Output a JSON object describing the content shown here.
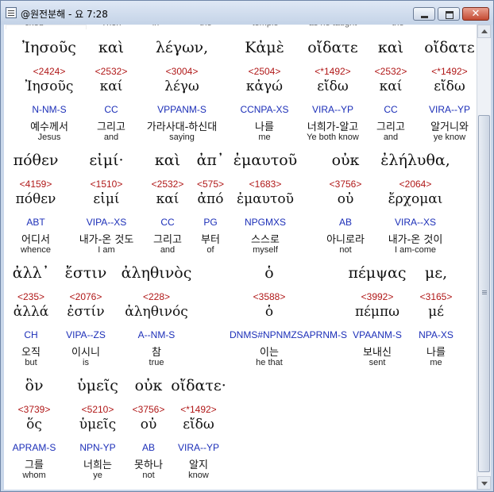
{
  "window": {
    "title": "@원전분해 - 요 7:28",
    "close_glyph": "✕"
  },
  "prev_line": [
    {
      "text": "cried"
    },
    {
      "text": "Then"
    },
    {
      "text": "in"
    },
    {
      "text": "the"
    },
    {
      "text": "temple"
    },
    {
      "text": "as he taught"
    },
    {
      "text": "the"
    }
  ],
  "verses": [
    {
      "words": [
        {
          "greek": "Ἰησοῦς",
          "strong": "<2424>",
          "lemma": "Ἰησοῦς",
          "parse": "N-NM-S",
          "korean": "예수께서",
          "english": "Jesus"
        },
        {
          "greek": "καὶ",
          "strong": "<2532>",
          "lemma": "καί",
          "parse": "CC",
          "korean": "그리고",
          "english": "and"
        },
        {
          "greek": "λέγων,",
          "strong": "<3004>",
          "lemma": "λέγω",
          "parse": "VPPANM-S",
          "korean": "가라사대-하신대",
          "english": "saying"
        },
        {
          "greek": "Κἀμὲ",
          "strong": "<2504>",
          "lemma": "κἀγώ",
          "parse": "CCNPA-XS",
          "korean": "나를",
          "english": "me"
        },
        {
          "greek": "οἴδατε",
          "strong": "<*1492>",
          "lemma": "εἴδω",
          "parse": "VIRA--YP",
          "korean": "너희가-알고",
          "english": "Ye both know"
        },
        {
          "greek": "καὶ",
          "strong": "<2532>",
          "lemma": "καί",
          "parse": "CC",
          "korean": "그리고",
          "english": "and"
        },
        {
          "greek": "οἴδατε",
          "strong": "<*1492>",
          "lemma": "εἴδω",
          "parse": "VIRA--YP",
          "korean": "알거니와",
          "english": "ye know"
        }
      ]
    },
    {
      "words": [
        {
          "greek": "πόθεν",
          "strong": "<4159>",
          "lemma": "πόθεν",
          "parse": "ABT",
          "korean": "어디서",
          "english": "whence"
        },
        {
          "greek": "εἰμί·",
          "strong": "<1510>",
          "lemma": "εἰμί",
          "parse": "VIPA--XS",
          "korean": "내가-온 것도",
          "english": "I am"
        },
        {
          "greek": "καὶ",
          "strong": "<2532>",
          "lemma": "καί",
          "parse": "CC",
          "korean": "그리고",
          "english": "and"
        },
        {
          "greek": "ἀπ᾽",
          "strong": "<575>",
          "lemma": "ἀπό",
          "parse": "PG",
          "korean": "부터",
          "english": "of"
        },
        {
          "greek": "ἐμαυτοῦ",
          "strong": "<1683>",
          "lemma": "ἐμαυτοῦ",
          "parse": "NPGMXS",
          "korean": "스스로",
          "english": "myself"
        },
        {
          "greek": "οὐκ",
          "strong": "<3756>",
          "lemma": "οὐ",
          "parse": "AB",
          "korean": "아니로라",
          "english": "not"
        },
        {
          "greek": "ἐλήλυθα,",
          "strong": "<2064>",
          "lemma": "ἔρχομαι",
          "parse": "VIRA--XS",
          "korean": "내가-온 것이",
          "english": "I am-come"
        }
      ]
    },
    {
      "words": [
        {
          "greek": "ἀλλ᾽",
          "strong": "<235>",
          "lemma": "ἀλλά",
          "parse": "CH",
          "korean": "오직",
          "english": "but"
        },
        {
          "greek": "ἔστιν",
          "strong": "<2076>",
          "lemma": "ἐστίν",
          "parse": "VIPA--ZS",
          "korean": "이시니",
          "english": "is"
        },
        {
          "greek": "ἀληθινὸς",
          "strong": "<228>",
          "lemma": "ἀληθινός",
          "parse": "A--NM-S",
          "korean": "참",
          "english": "true"
        },
        {
          "greek": "ὁ",
          "strong": "<3588>",
          "lemma": "ὁ",
          "parse": "DNMS#NPNMZSAPRNM-S",
          "korean": "이는",
          "english": "he that"
        },
        {
          "greek": "πέμψας",
          "strong": "<3992>",
          "lemma": "πέμπω",
          "parse": "VPAANM-S",
          "korean": "보내신",
          "english": "sent"
        },
        {
          "greek": "με,",
          "strong": "<3165>",
          "lemma": "μέ",
          "parse": "NPA-XS",
          "korean": "나를",
          "english": "me"
        }
      ]
    },
    {
      "words": [
        {
          "greek": "ὃν",
          "strong": "<3739>",
          "lemma": "ὅς",
          "parse": "APRAM-S",
          "korean": "그를",
          "english": "whom"
        },
        {
          "greek": "ὑμεῖς",
          "strong": "<5210>",
          "lemma": "ὑμεῖς",
          "parse": "NPN-YP",
          "korean": "너희는",
          "english": "ye"
        },
        {
          "greek": "οὐκ",
          "strong": "<3756>",
          "lemma": "οὐ",
          "parse": "AB",
          "korean": "못하나",
          "english": "not"
        },
        {
          "greek": "οἴδατε·",
          "strong": "<*1492>",
          "lemma": "εἴδω",
          "parse": "VIRA--YP",
          "korean": "알지",
          "english": "know"
        }
      ]
    }
  ]
}
